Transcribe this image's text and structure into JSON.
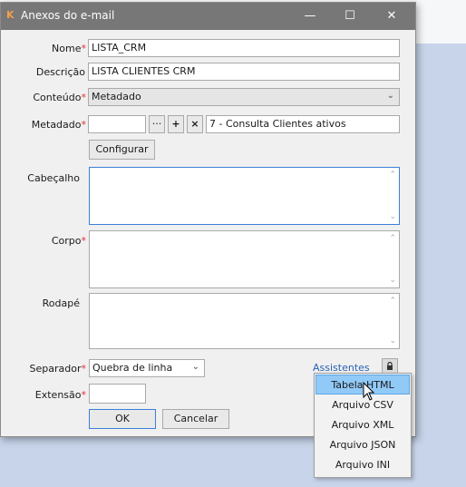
{
  "window": {
    "title": "Anexos do e-mail",
    "app_icon": "K",
    "minimize": "—",
    "maximize": "☐",
    "close": "✕"
  },
  "form": {
    "required_mark": "*",
    "nome": {
      "label": "Nome",
      "value": "LISTA_CRM"
    },
    "descricao": {
      "label": "Descrição",
      "value": "LISTA CLIENTES CRM"
    },
    "conteudo": {
      "label": "Conteúdo",
      "value": "Metadado"
    },
    "metadado": {
      "label": "Metadado",
      "value": "",
      "browse_label": "···",
      "add_label": "+",
      "remove_label": "×",
      "description": "7 - Consulta Clientes ativos"
    },
    "configurar_label": "Configurar",
    "cabecalho": {
      "label": "Cabeçalho"
    },
    "corpo": {
      "label": "Corpo"
    },
    "rodape": {
      "label": "Rodapé"
    },
    "separador": {
      "label": "Separador",
      "value": "Quebra de linha"
    },
    "assistentes_label": "Assistentes",
    "extensao": {
      "label": "Extensão",
      "value": ""
    },
    "ok_label": "OK",
    "cancel_label": "Cancelar"
  },
  "dropdown_menu": {
    "items": [
      "Tabela HTML",
      "Arquivo CSV",
      "Arquivo XML",
      "Arquivo JSON",
      "Arquivo INI"
    ],
    "selected": "Tabela HTML"
  },
  "colors": {
    "titlebar": "#777777",
    "accent_focus": "#3b7fd8",
    "link": "#2a62b8",
    "menu_highlight": "#91c9f7"
  }
}
